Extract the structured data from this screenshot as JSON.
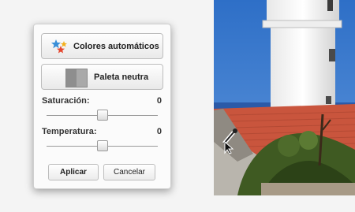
{
  "panel": {
    "auto_colors_label": "Colores automáticos",
    "neutral_palette_label": "Paleta neutra",
    "saturation": {
      "label": "Saturación:",
      "value": "0",
      "level": 0.5
    },
    "temperature": {
      "label": "Temperatura:",
      "value": "0",
      "level": 0.5
    },
    "apply_label": "Aplicar",
    "cancel_label": "Cancelar"
  },
  "colors": {
    "swatch_left": "#8e8e8e",
    "swatch_right": "#a9a9a9"
  },
  "icons": {
    "auto_colors": "colorful-stars-icon",
    "neutral_palette": "gray-swatch-icon",
    "eyedropper_cursor": "eyedropper-icon"
  }
}
